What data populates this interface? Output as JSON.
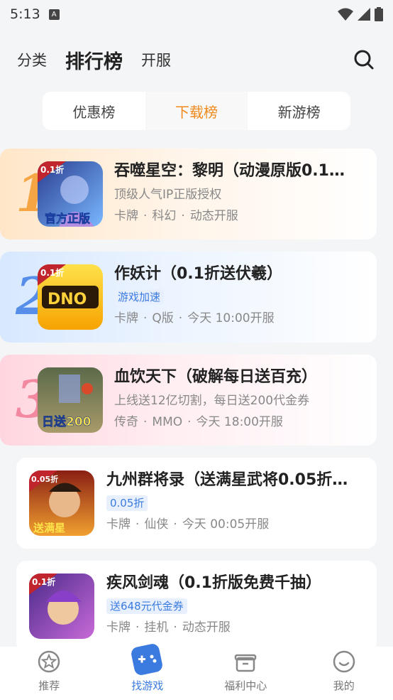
{
  "status": {
    "time": "5:13",
    "sim": "A"
  },
  "header": {
    "tabs": [
      {
        "label": "分类"
      },
      {
        "label": "排行榜"
      },
      {
        "label": "开服"
      }
    ]
  },
  "segment": {
    "items": [
      {
        "label": "优惠榜"
      },
      {
        "label": "下载榜"
      },
      {
        "label": "新游榜"
      }
    ],
    "active_color": "#f08a1c"
  },
  "games": [
    {
      "rank": "1",
      "title": "吞噬星空：黎明（动漫原版0.1…",
      "subtitle": "顶级人气IP正版授权",
      "tag": "",
      "meta": [
        "卡牌",
        "科幻",
        "动态开服"
      ],
      "icon_badge": "0.1折",
      "icon_caption": "官方正版"
    },
    {
      "rank": "2",
      "title": "作妖计（0.1折送伏羲）",
      "subtitle": "",
      "tag": "游戏加速",
      "meta": [
        "卡牌",
        "Q版",
        "今天 10:00开服"
      ],
      "icon_badge": "0.1折",
      "icon_caption": "DNO"
    },
    {
      "rank": "3",
      "title": "血饮天下（破解每日送百充）",
      "subtitle": "上线送12亿切割，每日送200代金券",
      "tag": "",
      "meta": [
        "传奇",
        "MMO",
        "今天 18:00开服"
      ],
      "icon_badge": "",
      "icon_caption": "日送200"
    },
    {
      "rank": "",
      "title": "九州群将录（送满星武将0.05折…",
      "subtitle": "",
      "tag": "0.05折",
      "meta": [
        "卡牌",
        "仙侠",
        "今天 00:05开服"
      ],
      "icon_badge": "0.05折",
      "icon_caption": "送满星"
    },
    {
      "rank": "",
      "title": "疾风剑魂（0.1折版免费千抽）",
      "subtitle": "",
      "tag": "送648元代金券",
      "meta": [
        "卡牌",
        "挂机",
        "动态开服"
      ],
      "icon_badge": "0.1折",
      "icon_caption": ""
    }
  ],
  "bottom_nav": [
    {
      "label": "推荐"
    },
    {
      "label": "找游戏"
    },
    {
      "label": "福利中心"
    },
    {
      "label": "我的"
    }
  ],
  "colors": {
    "accent_orange": "#f08a1c",
    "accent_blue": "#3b7be0"
  }
}
